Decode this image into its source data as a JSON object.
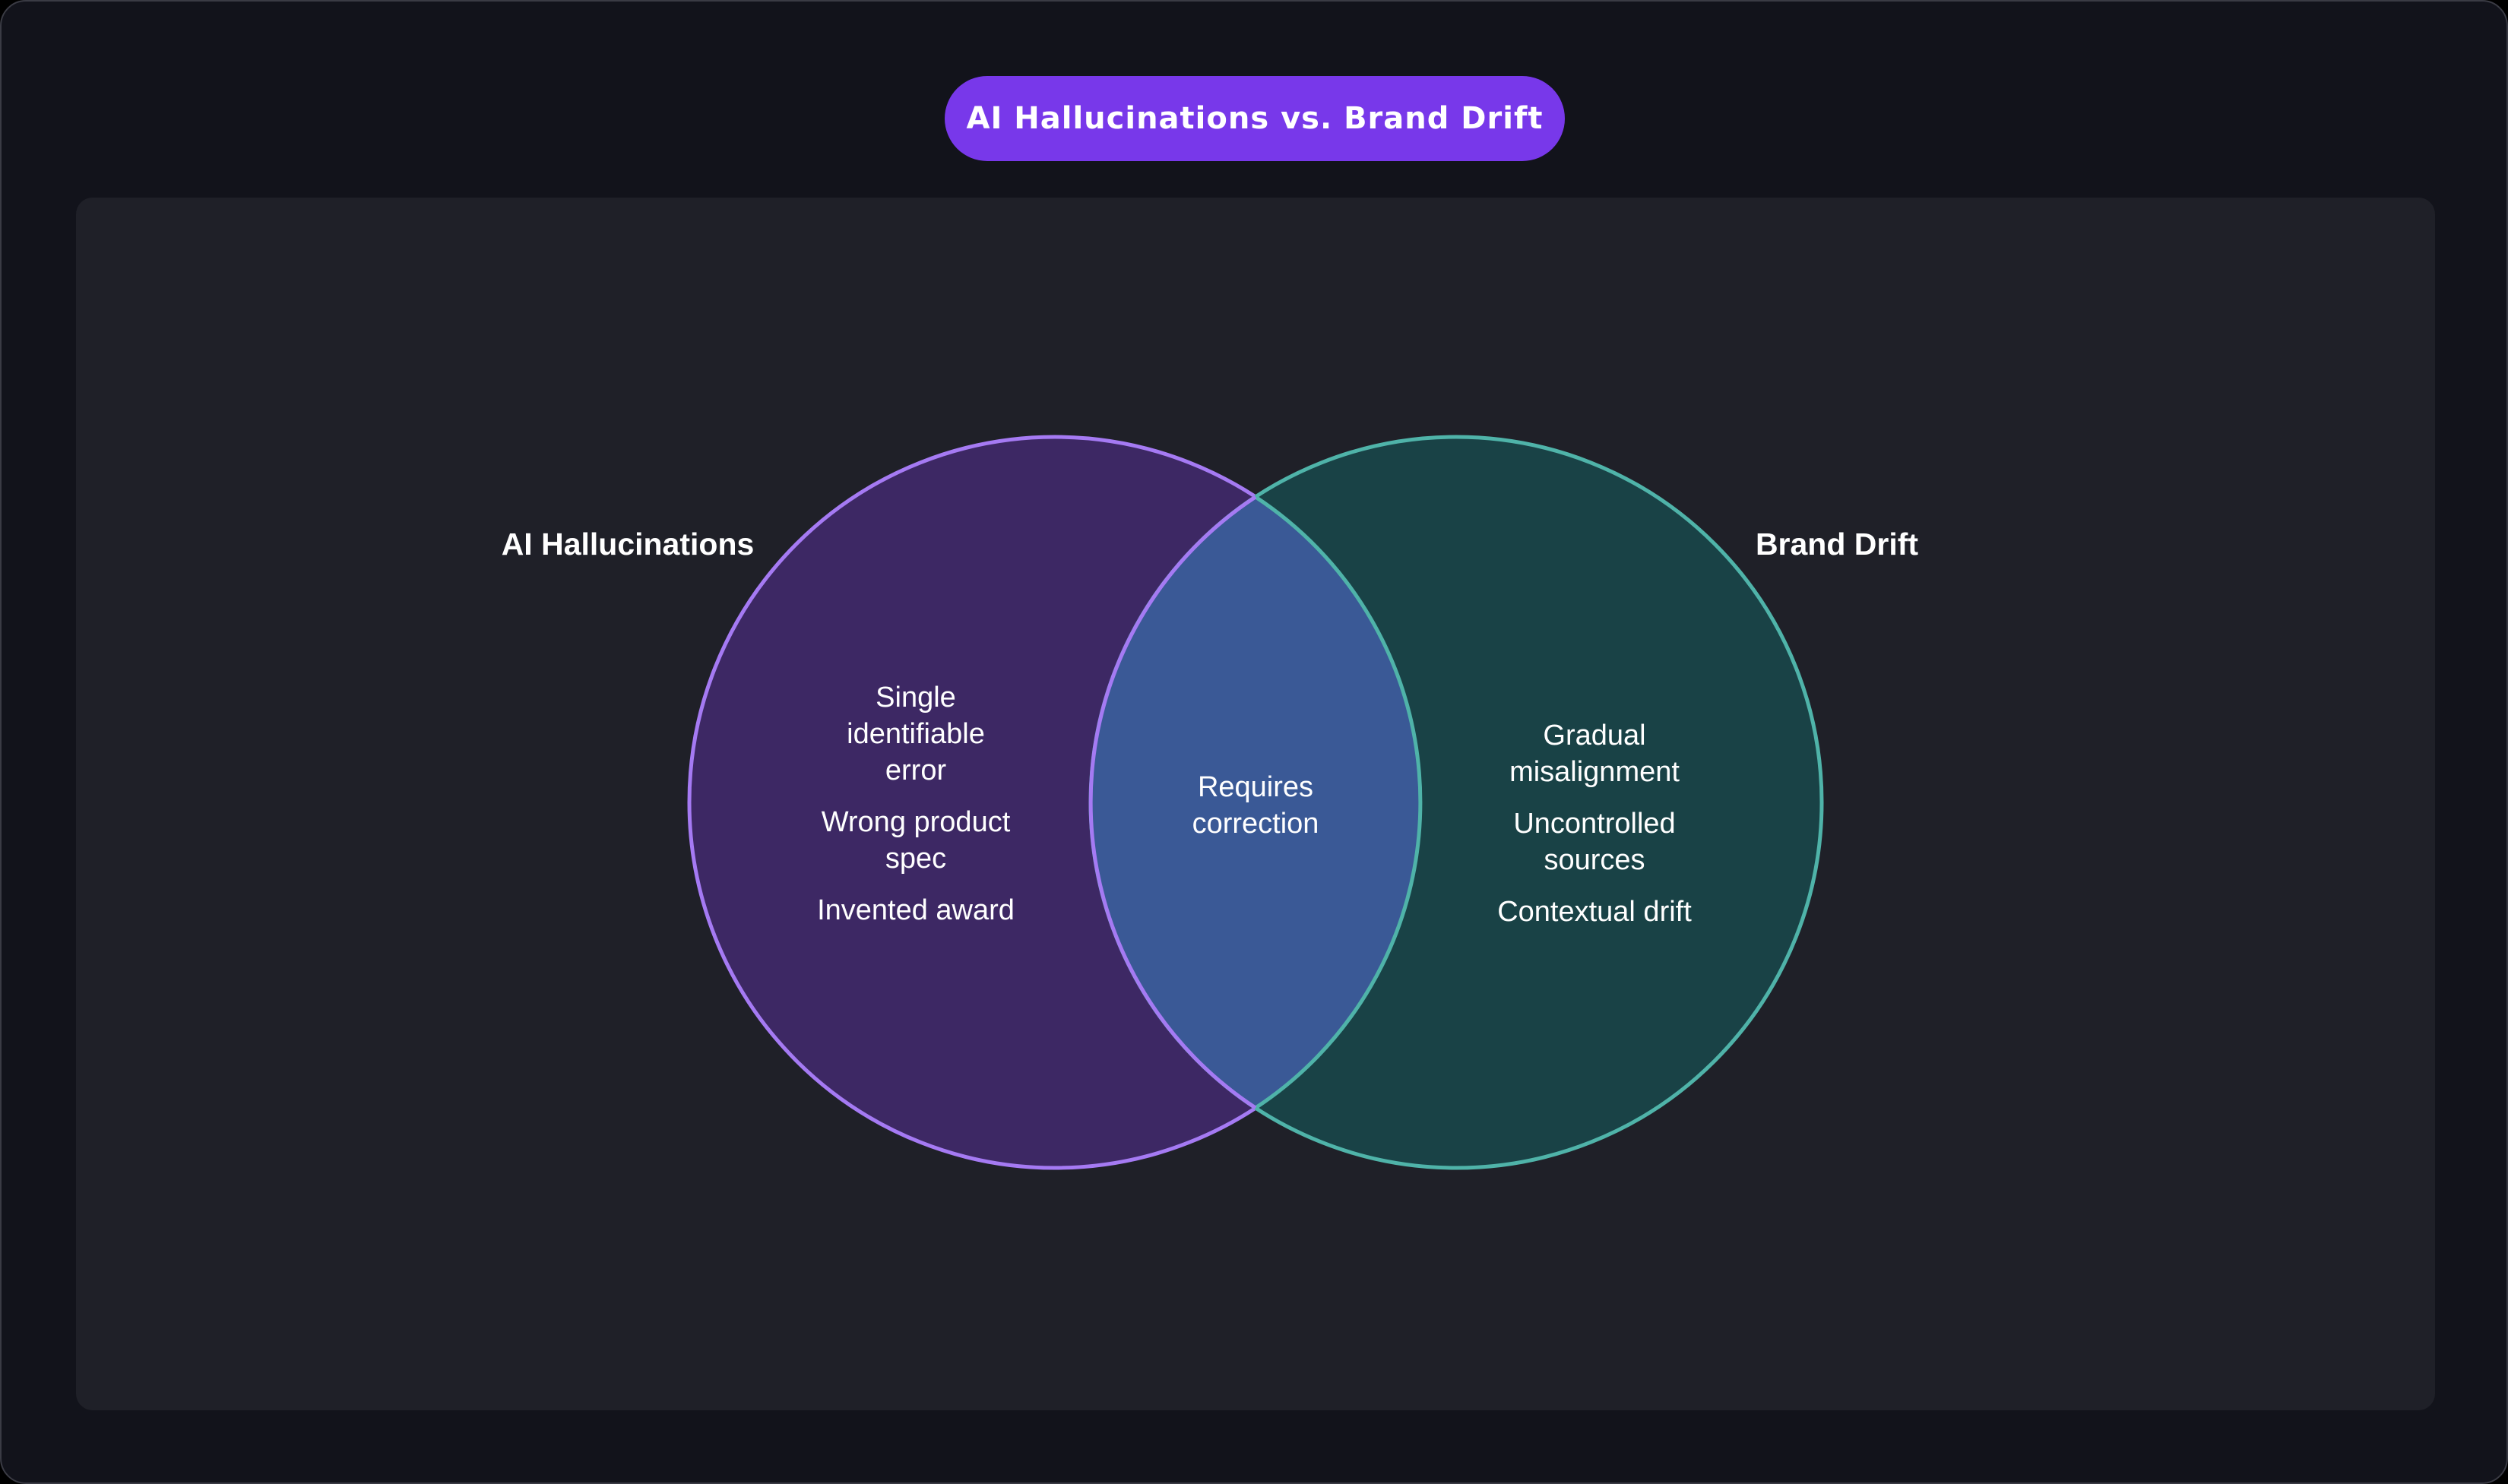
{
  "title": "AI Hallucinations vs. Brand Drift",
  "colors": {
    "frame_background": "#12131b",
    "canvas_background": "#1f2028",
    "title_pill": "#7838ea",
    "left_set_fill": "#3d2864",
    "left_set_stroke": "#a57af3",
    "right_set_fill": "#194246",
    "right_set_stroke": "#4fb3a9",
    "overlap_fill": "#3a5996"
  },
  "venn": {
    "left": {
      "label": "AI Hallucinations",
      "items": [
        [
          "Single",
          "identifiable",
          "error"
        ],
        [
          "Wrong product",
          "spec"
        ],
        [
          "Invented award"
        ]
      ]
    },
    "right": {
      "label": "Brand Drift",
      "items": [
        [
          "Gradual",
          "misalignment"
        ],
        [
          "Uncontrolled",
          "sources"
        ],
        [
          "Contextual drift"
        ]
      ]
    },
    "overlap": {
      "items": [
        [
          "Requires",
          "correction"
        ]
      ]
    }
  }
}
